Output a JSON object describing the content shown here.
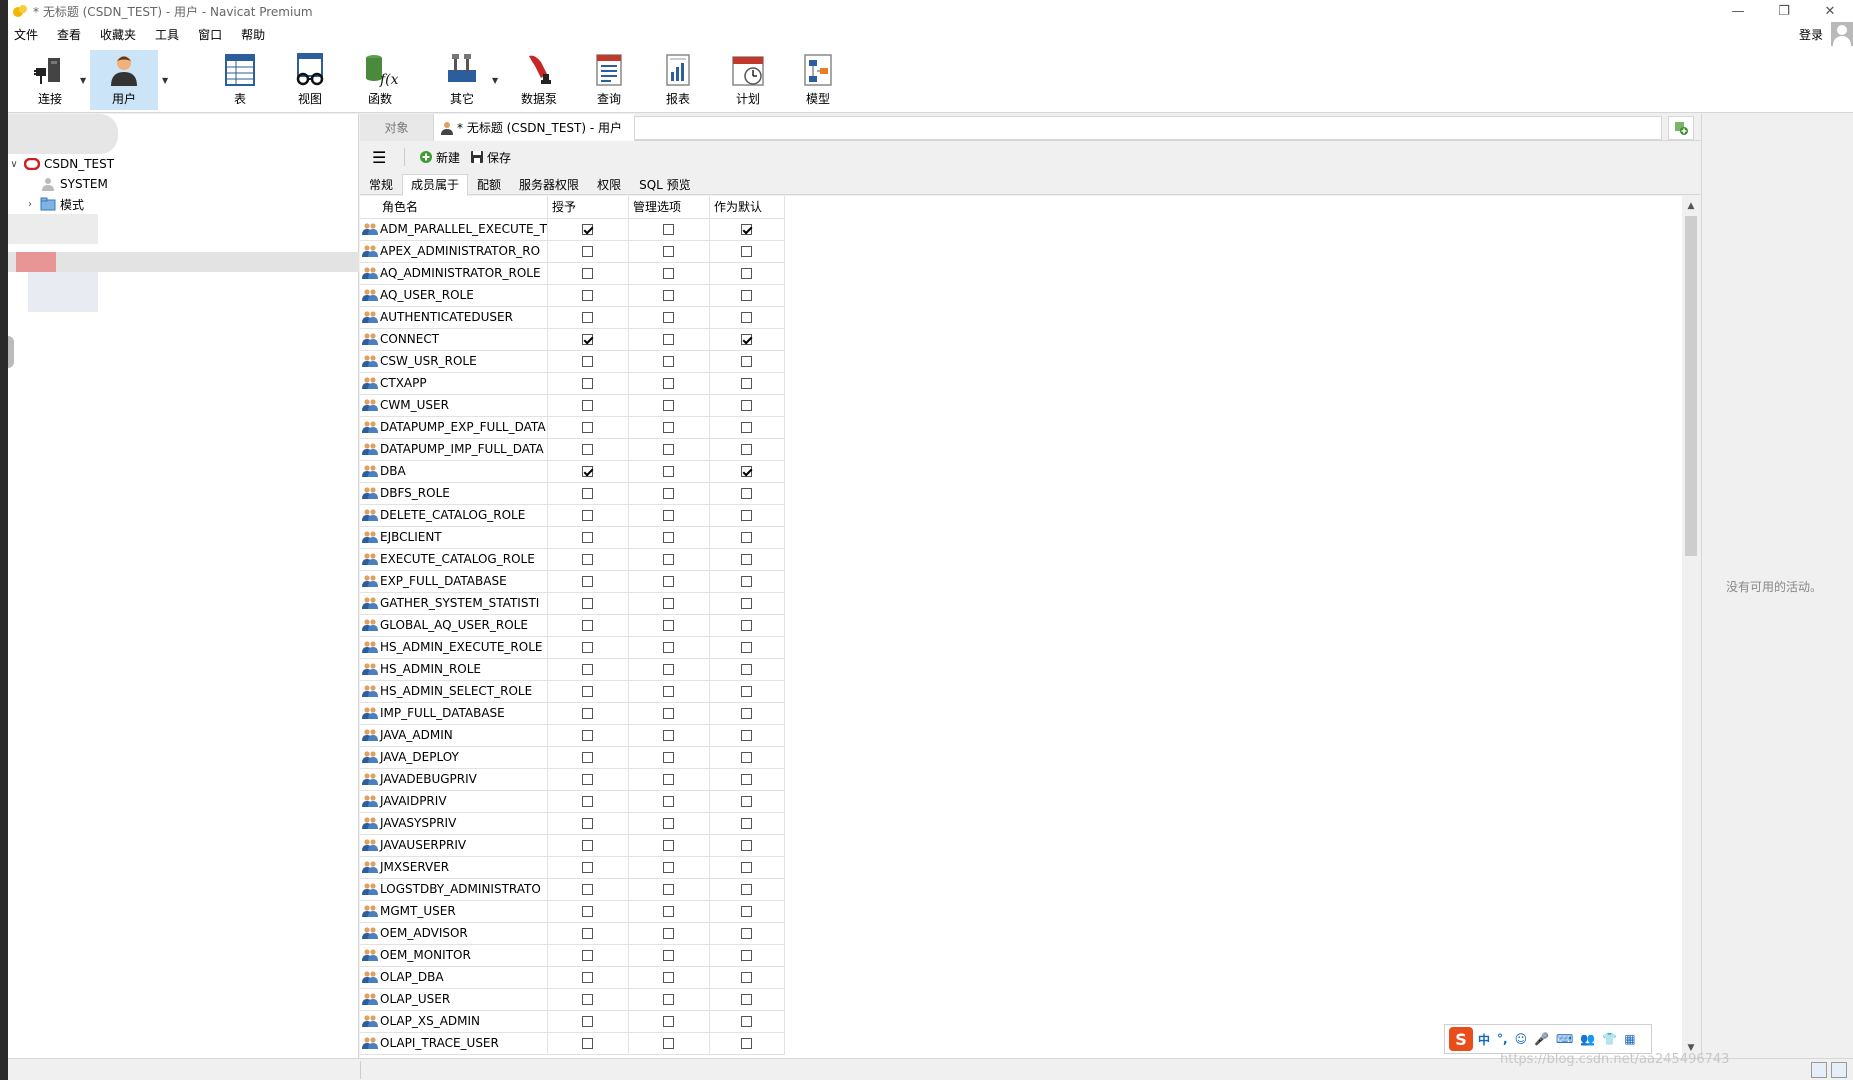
{
  "titlebar": {
    "title": "* 无标题 (CSDN_TEST) - 用户 - Navicat Premium",
    "minimize": "—",
    "restore": "❐",
    "close": "✕"
  },
  "menubar": {
    "items": [
      "文件",
      "查看",
      "收藏夹",
      "工具",
      "窗口",
      "帮助"
    ],
    "login": "登录"
  },
  "toolbar": {
    "buttons": [
      {
        "label": "连接",
        "icon": "plug-icon"
      },
      {
        "label": "用户",
        "icon": "user-icon"
      },
      {
        "label": "表",
        "icon": "table-icon"
      },
      {
        "label": "视图",
        "icon": "view-icon"
      },
      {
        "label": "函数",
        "icon": "function-icon"
      },
      {
        "label": "其它",
        "icon": "tools-icon"
      },
      {
        "label": "数据泵",
        "icon": "pump-icon"
      },
      {
        "label": "查询",
        "icon": "query-icon"
      },
      {
        "label": "报表",
        "icon": "report-icon"
      },
      {
        "label": "计划",
        "icon": "schedule-icon"
      },
      {
        "label": "模型",
        "icon": "model-icon"
      }
    ]
  },
  "sidebar": {
    "connection": "CSDN_TEST",
    "items": [
      "SYSTEM",
      "模式"
    ]
  },
  "tabs": {
    "objects": "对象",
    "document": "* 无标题 (CSDN_TEST) - 用户"
  },
  "editor_toolbar": {
    "new": "新建",
    "save": "保存"
  },
  "subtabs": [
    "常规",
    "成员属于",
    "配额",
    "服务器权限",
    "权限",
    "SQL 预览"
  ],
  "grid": {
    "columns": [
      "角色名",
      "授予",
      "管理选项",
      "作为默认"
    ],
    "rows": [
      {
        "name": "ADM_PARALLEL_EXECUTE_T",
        "grant": true,
        "admin": false,
        "default": true
      },
      {
        "name": "APEX_ADMINISTRATOR_RO",
        "grant": false,
        "admin": false,
        "default": false
      },
      {
        "name": "AQ_ADMINISTRATOR_ROLE",
        "grant": false,
        "admin": false,
        "default": false
      },
      {
        "name": "AQ_USER_ROLE",
        "grant": false,
        "admin": false,
        "default": false
      },
      {
        "name": "AUTHENTICATEDUSER",
        "grant": false,
        "admin": false,
        "default": false
      },
      {
        "name": "CONNECT",
        "grant": true,
        "admin": false,
        "default": true
      },
      {
        "name": "CSW_USR_ROLE",
        "grant": false,
        "admin": false,
        "default": false
      },
      {
        "name": "CTXAPP",
        "grant": false,
        "admin": false,
        "default": false
      },
      {
        "name": "CWM_USER",
        "grant": false,
        "admin": false,
        "default": false
      },
      {
        "name": "DATAPUMP_EXP_FULL_DATA",
        "grant": false,
        "admin": false,
        "default": false
      },
      {
        "name": "DATAPUMP_IMP_FULL_DATA",
        "grant": false,
        "admin": false,
        "default": false
      },
      {
        "name": "DBA",
        "grant": true,
        "admin": false,
        "default": true
      },
      {
        "name": "DBFS_ROLE",
        "grant": false,
        "admin": false,
        "default": false
      },
      {
        "name": "DELETE_CATALOG_ROLE",
        "grant": false,
        "admin": false,
        "default": false
      },
      {
        "name": "EJBCLIENT",
        "grant": false,
        "admin": false,
        "default": false
      },
      {
        "name": "EXECUTE_CATALOG_ROLE",
        "grant": false,
        "admin": false,
        "default": false
      },
      {
        "name": "EXP_FULL_DATABASE",
        "grant": false,
        "admin": false,
        "default": false
      },
      {
        "name": "GATHER_SYSTEM_STATISTI",
        "grant": false,
        "admin": false,
        "default": false
      },
      {
        "name": "GLOBAL_AQ_USER_ROLE",
        "grant": false,
        "admin": false,
        "default": false
      },
      {
        "name": "HS_ADMIN_EXECUTE_ROLE",
        "grant": false,
        "admin": false,
        "default": false
      },
      {
        "name": "HS_ADMIN_ROLE",
        "grant": false,
        "admin": false,
        "default": false
      },
      {
        "name": "HS_ADMIN_SELECT_ROLE",
        "grant": false,
        "admin": false,
        "default": false
      },
      {
        "name": "IMP_FULL_DATABASE",
        "grant": false,
        "admin": false,
        "default": false
      },
      {
        "name": "JAVA_ADMIN",
        "grant": false,
        "admin": false,
        "default": false
      },
      {
        "name": "JAVA_DEPLOY",
        "grant": false,
        "admin": false,
        "default": false
      },
      {
        "name": "JAVADEBUGPRIV",
        "grant": false,
        "admin": false,
        "default": false
      },
      {
        "name": "JAVAIDPRIV",
        "grant": false,
        "admin": false,
        "default": false
      },
      {
        "name": "JAVASYSPRIV",
        "grant": false,
        "admin": false,
        "default": false
      },
      {
        "name": "JAVAUSERPRIV",
        "grant": false,
        "admin": false,
        "default": false
      },
      {
        "name": "JMXSERVER",
        "grant": false,
        "admin": false,
        "default": false
      },
      {
        "name": "LOGSTDBY_ADMINISTRATO",
        "grant": false,
        "admin": false,
        "default": false
      },
      {
        "name": "MGMT_USER",
        "grant": false,
        "admin": false,
        "default": false
      },
      {
        "name": "OEM_ADVISOR",
        "grant": false,
        "admin": false,
        "default": false
      },
      {
        "name": "OEM_MONITOR",
        "grant": false,
        "admin": false,
        "default": false
      },
      {
        "name": "OLAP_DBA",
        "grant": false,
        "admin": false,
        "default": false
      },
      {
        "name": "OLAP_USER",
        "grant": false,
        "admin": false,
        "default": false
      },
      {
        "name": "OLAP_XS_ADMIN",
        "grant": false,
        "admin": false,
        "default": false
      },
      {
        "name": "OLAPI_TRACE_USER",
        "grant": false,
        "admin": false,
        "default": false
      }
    ]
  },
  "right_panel": {
    "no_activity": "没有可用的活动。"
  },
  "ime": {
    "logo": "S",
    "items": [
      "中",
      "°,",
      "☺",
      "🎤",
      "⌨",
      "👥",
      "👕",
      "▦"
    ]
  },
  "watermark": "https://blog.csdn.net/aa245496743",
  "colors": {
    "active_toolbar": "#cce4f7",
    "connection_red": "#cc2222",
    "ime_red": "#e84d1c"
  }
}
